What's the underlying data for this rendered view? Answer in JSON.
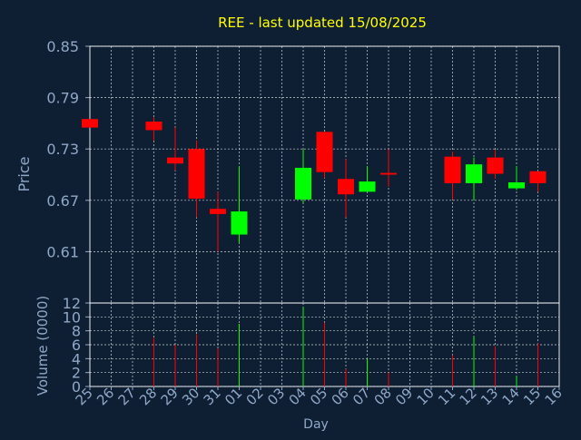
{
  "chart_data": {
    "type": "candlestick",
    "title": "REE - last updated 15/08/2025",
    "xlabel": "Day",
    "price_panel": {
      "ylabel": "Price",
      "yticks": [
        0.61,
        0.67,
        0.73,
        0.79,
        0.85
      ],
      "ytick_labels": [
        "0.61",
        "0.67",
        "0.73",
        "0.79",
        "0.85"
      ],
      "ylim": [
        0.55,
        0.85
      ],
      "grid": true
    },
    "volume_panel": {
      "ylabel": "Volume (0000)",
      "yticks": [
        0,
        2,
        4,
        6,
        8,
        10,
        12
      ],
      "ytick_labels": [
        "0",
        "2",
        "4",
        "6",
        "8",
        "10",
        "12"
      ],
      "ylim": [
        0,
        12
      ],
      "grid": true
    },
    "up_color": "#00ff00",
    "down_color": "#ff0000",
    "days": [
      "25",
      "26",
      "27",
      "28",
      "29",
      "30",
      "31",
      "01",
      "02",
      "03",
      "04",
      "05",
      "06",
      "07",
      "08",
      "09",
      "10",
      "11",
      "12",
      "13",
      "14",
      "15",
      "16"
    ],
    "candles": [
      {
        "day": "25",
        "open": 0.765,
        "close": 0.755,
        "high": 0.765,
        "low": 0.755,
        "volume": 0
      },
      {
        "day": "28",
        "open": 0.762,
        "close": 0.752,
        "high": 0.767,
        "low": 0.74,
        "volume": 7.0
      },
      {
        "day": "29",
        "open": 0.72,
        "close": 0.713,
        "high": 0.755,
        "low": 0.705,
        "volume": 6.0
      },
      {
        "day": "30",
        "open": 0.73,
        "close": 0.672,
        "high": 0.74,
        "low": 0.65,
        "volume": 7.5
      },
      {
        "day": "31",
        "open": 0.66,
        "close": 0.654,
        "high": 0.68,
        "low": 0.61,
        "volume": 5.5
      },
      {
        "day": "01",
        "open": 0.63,
        "close": 0.657,
        "high": 0.71,
        "low": 0.62,
        "volume": 9.0
      },
      {
        "day": "04",
        "open": 0.671,
        "close": 0.708,
        "high": 0.73,
        "low": 0.667,
        "volume": 11.5
      },
      {
        "day": "05",
        "open": 0.75,
        "close": 0.703,
        "high": 0.75,
        "low": 0.696,
        "volume": 9.2
      },
      {
        "day": "06",
        "open": 0.695,
        "close": 0.677,
        "high": 0.718,
        "low": 0.65,
        "volume": 2.5
      },
      {
        "day": "07",
        "open": 0.68,
        "close": 0.692,
        "high": 0.71,
        "low": 0.68,
        "volume": 4.0
      },
      {
        "day": "08",
        "open": 0.702,
        "close": 0.7,
        "high": 0.73,
        "low": 0.686,
        "volume": 2.0
      },
      {
        "day": "11",
        "open": 0.721,
        "close": 0.69,
        "high": 0.727,
        "low": 0.671,
        "volume": 4.5
      },
      {
        "day": "12",
        "open": 0.69,
        "close": 0.712,
        "high": 0.72,
        "low": 0.67,
        "volume": 7.2
      },
      {
        "day": "13",
        "open": 0.72,
        "close": 0.701,
        "high": 0.729,
        "low": 0.695,
        "volume": 5.8
      },
      {
        "day": "14",
        "open": 0.684,
        "close": 0.691,
        "high": 0.71,
        "low": 0.682,
        "volume": 1.5
      },
      {
        "day": "15",
        "open": 0.704,
        "close": 0.69,
        "high": 0.704,
        "low": 0.68,
        "volume": 6.2
      }
    ]
  },
  "colors": {
    "background": "#0f1f33",
    "text": "#8fa8c8",
    "title": "#ffff00",
    "grid": "#ffffff"
  }
}
